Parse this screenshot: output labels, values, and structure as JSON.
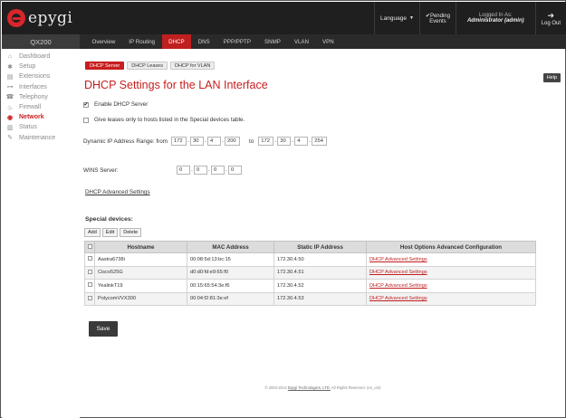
{
  "brand": {
    "logo_text": "epygi"
  },
  "topbar": {
    "language_label": "Language",
    "pending_line1": "✔Pending",
    "pending_line2": "Events",
    "logged_in_line1": "Logged In As:",
    "logged_in_line2": "Administrator (admin)",
    "logout_label": "Log Out"
  },
  "sidebar": {
    "device_title": "QX200",
    "items": [
      {
        "label": "Dashboard",
        "icon": "dashboard-icon"
      },
      {
        "label": "Setup",
        "icon": "gear-icon"
      },
      {
        "label": "Extensions",
        "icon": "book-icon"
      },
      {
        "label": "Interfaces",
        "icon": "network-icon"
      },
      {
        "label": "Telephony",
        "icon": "phone-icon"
      },
      {
        "label": "Firewall",
        "icon": "fire-icon"
      },
      {
        "label": "Network",
        "icon": "globe-icon",
        "active": true
      },
      {
        "label": "Status",
        "icon": "chart-icon"
      },
      {
        "label": "Maintenance",
        "icon": "wrench-icon"
      }
    ]
  },
  "tabs": [
    {
      "label": "Overview"
    },
    {
      "label": "IP Routing"
    },
    {
      "label": "DHCP",
      "active": true
    },
    {
      "label": "DNS"
    },
    {
      "label": "PPP/PPTP"
    },
    {
      "label": "SNMP"
    },
    {
      "label": "VLAN"
    },
    {
      "label": "VPN"
    }
  ],
  "subtabs": [
    {
      "label": "DHCP Server",
      "active": true
    },
    {
      "label": "DHCP Leases"
    },
    {
      "label": "DHCP for VLAN"
    }
  ],
  "help_label": "Help",
  "page_title": "DHCP Settings for the LAN Interface",
  "form": {
    "enable_label": "Enable DHCP Server",
    "enable_checked": true,
    "special_only_label": "Give leases only to hosts listed in the Special devices table.",
    "special_only_checked": false,
    "range_label": "Dynamic IP Address Range: from",
    "range_from": [
      "172",
      "30",
      "4",
      "200"
    ],
    "range_to_label": "to",
    "range_to": [
      "172",
      "30",
      "4",
      "254"
    ],
    "wins_label": "WINS Server:",
    "wins": [
      "0",
      "0",
      "0",
      "0"
    ],
    "advanced_link": "DHCP Advanced Settings"
  },
  "special_devices": {
    "heading": "Special devices:",
    "buttons": {
      "add": "Add",
      "edit": "Edit",
      "delete": "Delete"
    },
    "columns": [
      "Hostname",
      "MAC Address",
      "Static IP Address",
      "Host Options Advanced Configuration"
    ],
    "rows": [
      {
        "hostname": "Aastra6738i",
        "mac": "00:08:5d:13:bc:15",
        "ip": "172.30.4.50",
        "adv": "DHCP Advanced Settings"
      },
      {
        "hostname": "Cisco525G",
        "mac": "d0:d0:fd:e9:65:f0",
        "ip": "172.30.4.51",
        "adv": "DHCP Advanced Settings"
      },
      {
        "hostname": "YealinkT19",
        "mac": "00:15:65:54:3e:f6",
        "ip": "172.30.4.52",
        "adv": "DHCP Advanced Settings"
      },
      {
        "hostname": "PolycomVVX300",
        "mac": "00:04:f2:81:3e:ef",
        "ip": "172.30.4.53",
        "adv": "DHCP Advanced Settings"
      }
    ]
  },
  "save_label": "Save",
  "footer": {
    "prefix": "© 2003-2014",
    "company": "Epygi Technologies, LTD.",
    "suffix": "All Rights Reserved. (en_US)"
  },
  "colors": {
    "accent": "#c81e1e",
    "topbar": "#1f1f1f",
    "tabbar": "#2a2a2a"
  }
}
